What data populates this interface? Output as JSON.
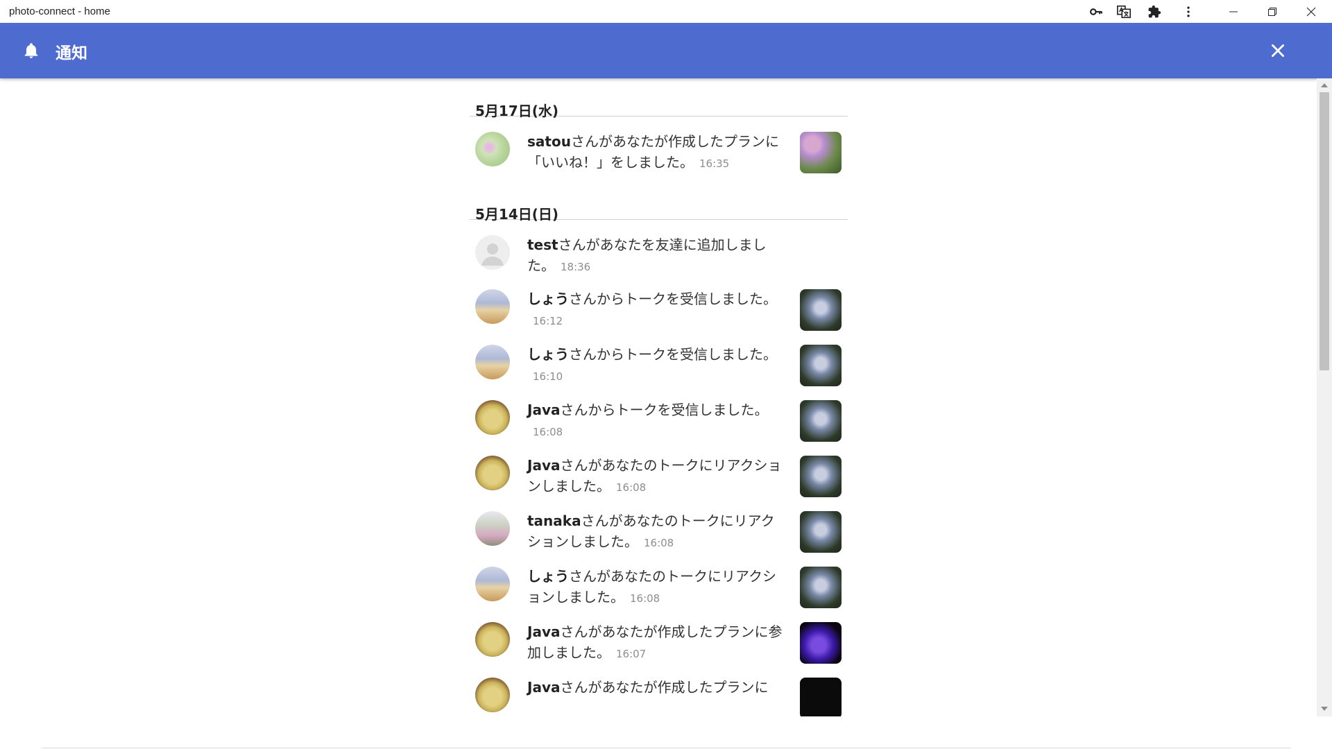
{
  "window": {
    "title": "photo-connect - home"
  },
  "appbar": {
    "title": "通知"
  },
  "groups": [
    {
      "date": "5月17日(水)",
      "items": [
        {
          "name": "satou",
          "text": "さんがあなたが作成したプランに「いいね！」をしました。",
          "time": "16:35",
          "avatar": "flower",
          "thumb": "dahlia"
        }
      ]
    },
    {
      "date": "5月14日(日)",
      "items": [
        {
          "name": "test",
          "text": "さんがあなたを友達に追加しました。",
          "time": "18:36",
          "avatar": "default",
          "thumb": ""
        },
        {
          "name": "しょう",
          "text": "さんからトークを受信しました。",
          "time": "16:12",
          "avatar": "icecream",
          "thumb": "hydrangea"
        },
        {
          "name": "しょう",
          "text": "さんからトークを受信しました。",
          "time": "16:10",
          "avatar": "icecream",
          "thumb": "hydrangea"
        },
        {
          "name": "Java",
          "text": "さんからトークを受信しました。",
          "time": "16:08",
          "avatar": "noodle",
          "thumb": "hydrangea"
        },
        {
          "name": "Java",
          "text": "さんがあなたのトークにリアクションしました。",
          "time": "16:08",
          "avatar": "noodle",
          "thumb": "hydrangea"
        },
        {
          "name": "tanaka",
          "text": "さんがあなたのトークにリアクションしました。",
          "time": "16:08",
          "avatar": "tanaka",
          "thumb": "hydrangea"
        },
        {
          "name": "しょう",
          "text": "さんがあなたのトークにリアクションしました。",
          "time": "16:08",
          "avatar": "icecream",
          "thumb": "hydrangea"
        },
        {
          "name": "Java",
          "text": "さんがあなたが作成したプランに参加しました。",
          "time": "16:07",
          "avatar": "noodle",
          "thumb": "violet"
        },
        {
          "name": "Java",
          "text": "さんがあなたが作成したプランに",
          "time": "",
          "avatar": "noodle",
          "thumb": "dark"
        }
      ]
    }
  ],
  "icons": {
    "bell": "bell-icon",
    "close": "close-icon",
    "key": "key-icon",
    "translate": "translate-icon",
    "extensions": "puzzle-icon",
    "menu": "more-vert-icon"
  },
  "colors": {
    "appbar": "#4e6bcf",
    "time": "#8d8d8d"
  }
}
